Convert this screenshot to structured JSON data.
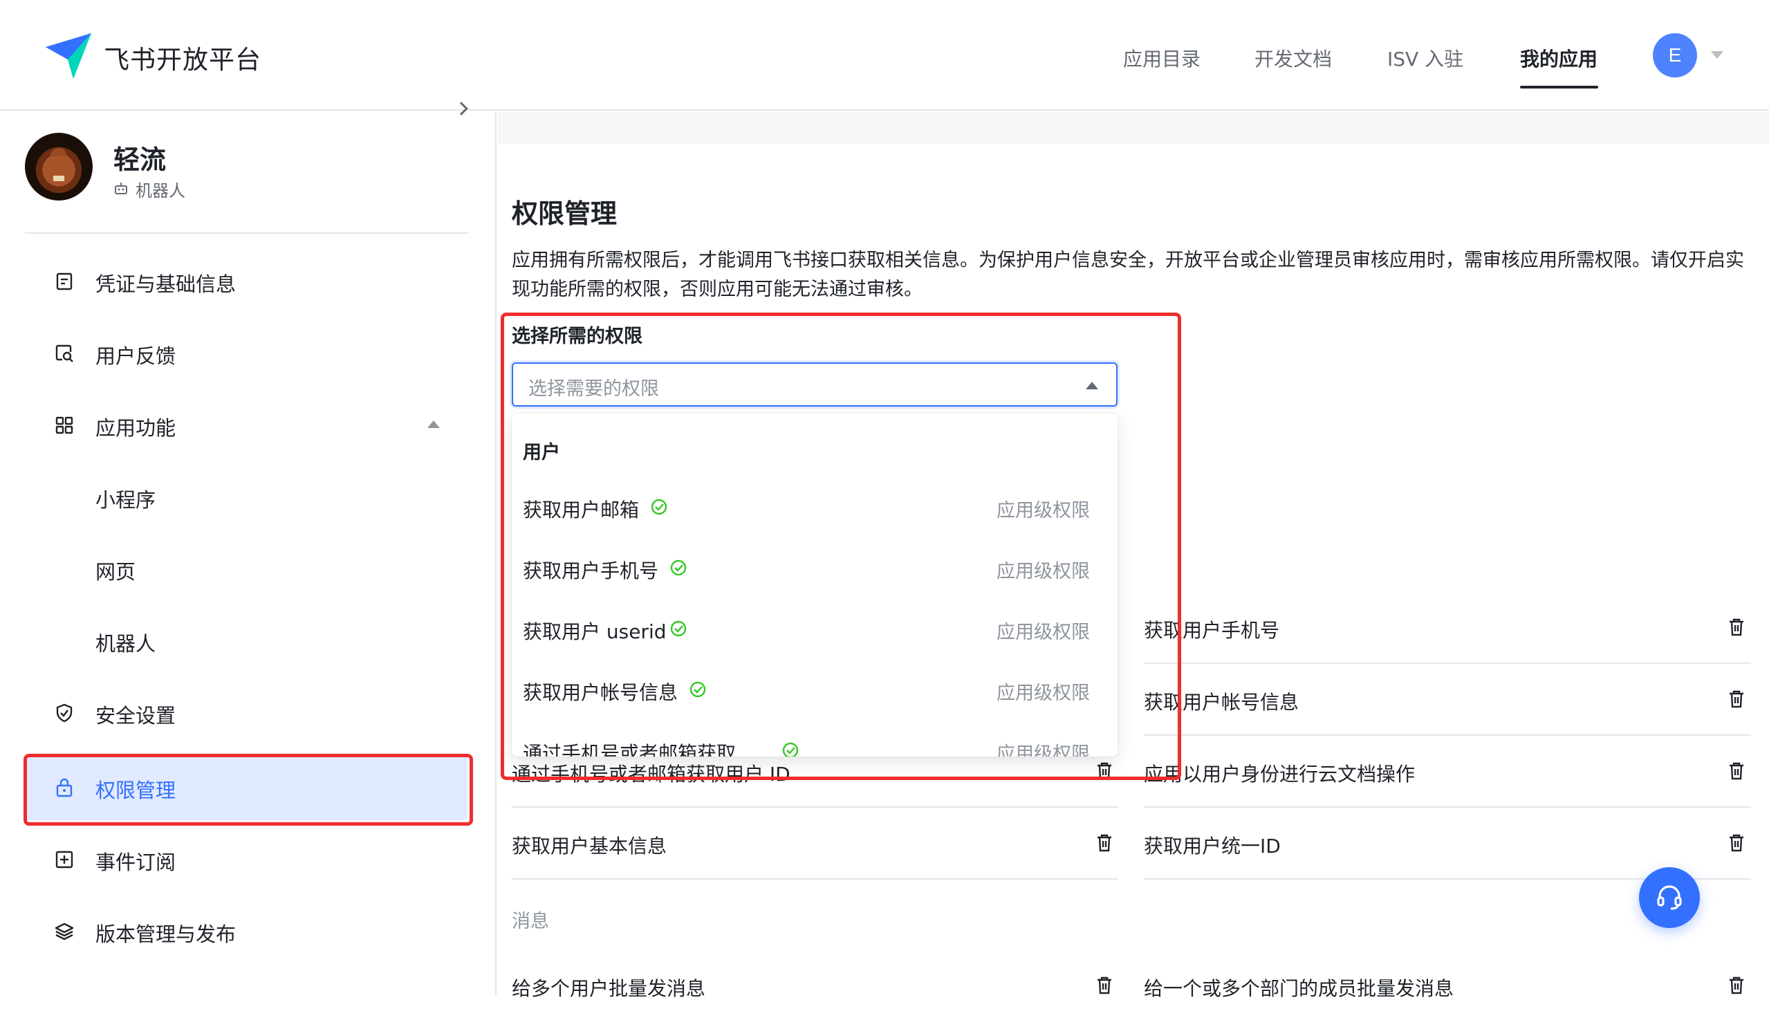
{
  "header": {
    "brand": "飞书开放平台",
    "nav": [
      "应用目录",
      "开发文档",
      "ISV 入驻",
      "我的应用"
    ],
    "active_nav": "我的应用",
    "avatar_letter": "E"
  },
  "sidebar": {
    "app_name": "轻流",
    "app_type": "机器人",
    "items": [
      {
        "label": "凭证与基础信息",
        "icon": "credential-icon"
      },
      {
        "label": "用户反馈",
        "icon": "feedback-icon"
      },
      {
        "label": "应用功能",
        "icon": "grid-icon"
      },
      {
        "label": "小程序"
      },
      {
        "label": "网页"
      },
      {
        "label": "机器人"
      },
      {
        "label": "安全设置",
        "icon": "shield-icon"
      },
      {
        "label": "权限管理",
        "icon": "lock-icon"
      },
      {
        "label": "事件订阅",
        "icon": "event-icon"
      },
      {
        "label": "版本管理与发布",
        "icon": "layers-icon"
      }
    ]
  },
  "main": {
    "title": "权限管理",
    "description": "应用拥有所需权限后，才能调用飞书接口获取相关信息。为保护用户信息安全，开放平台或企业管理员审核应用时，需审核应用所需权限。请仅开启实现功能所需的权限，否则应用可能无法通过审核。",
    "select_label": "选择所需的权限",
    "select_placeholder": "选择需要的权限",
    "permissions_left": [
      "通过手机号或者邮箱获取用户 ID",
      "获取用户基本信息"
    ],
    "permissions_right": [
      "获取用户手机号",
      "获取用户帐号信息",
      "应用以用户身份进行云文档操作",
      "获取用户统一ID"
    ],
    "section_message": "消息",
    "message_left": "给多个用户批量发消息",
    "message_right": "给一个或多个部门的成员批量发消息"
  },
  "dropdown": {
    "group": "用户",
    "items": [
      {
        "label": "获取用户邮箱",
        "level": "应用级权限"
      },
      {
        "label": "获取用户手机号",
        "level": "应用级权限"
      },
      {
        "label": "获取用户 userid",
        "level": "应用级权限"
      },
      {
        "label": "获取用户帐号信息",
        "level": "应用级权限"
      },
      {
        "label": "通过手机号或者邮箱获取",
        "level": "应用级权限"
      }
    ]
  },
  "colors": {
    "accent": "#3370ff",
    "highlight_box": "#f02d2d",
    "check": "#34c724"
  }
}
